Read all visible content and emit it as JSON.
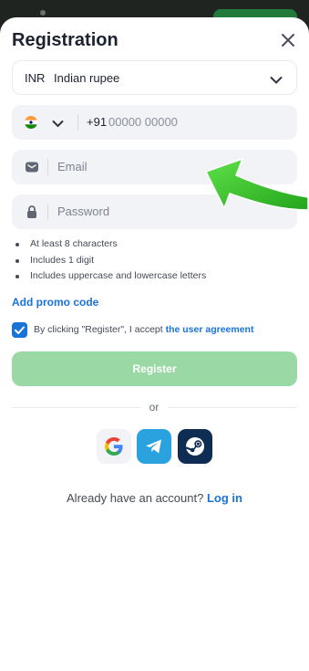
{
  "header": {
    "title": "Registration"
  },
  "currency": {
    "code": "INR",
    "name": "Indian rupee"
  },
  "phone": {
    "country_code": "+91",
    "placeholder": "00000 00000"
  },
  "email": {
    "placeholder": "Email"
  },
  "password": {
    "placeholder": "Password",
    "rules": [
      "At least 8 characters",
      "Includes 1 digit",
      "Includes uppercase and lowercase letters"
    ]
  },
  "promo": {
    "label": "Add promo code"
  },
  "agreement": {
    "checked": true,
    "text": "By clicking \"Register\", I accept ",
    "link": "the user agreement"
  },
  "register": {
    "label": "Register"
  },
  "divider": {
    "label": "or"
  },
  "social": [
    "google-icon",
    "telegram-icon",
    "steam-icon"
  ],
  "login": {
    "text": "Already have an account?",
    "link": "Log in"
  },
  "colors": {
    "accent": "#1a73d9",
    "register_disabled": "#9ad9a5",
    "annotation_arrow": "#2fc41f"
  }
}
